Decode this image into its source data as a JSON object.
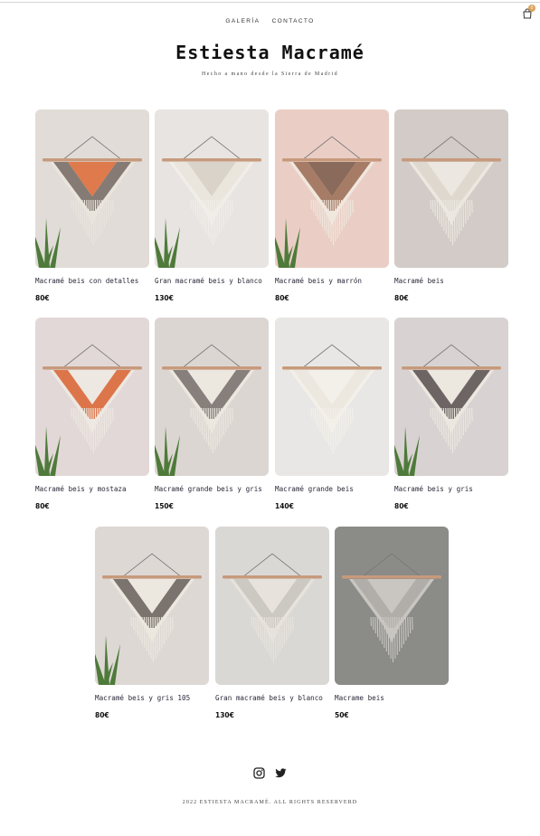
{
  "header": {
    "nav": [
      "GALERÍA",
      "CONTACTO"
    ],
    "cart_count": "0",
    "cart_icon": "shopping-bag-icon"
  },
  "site": {
    "title": "Estiesta Macramé",
    "subtitle": "Hecho a mano desde la Sierra de Madrid"
  },
  "products": [
    {
      "name": "Macramé beis con detalles",
      "price": "80€",
      "bg": "#ddd8d3",
      "tones": [
        "#e9e4dc",
        "#7a6f68",
        "#de7a4c"
      ],
      "plant": true
    },
    {
      "name": "Gran macramé beis y blanco",
      "price": "130€",
      "bg": "#e4e1dd",
      "tones": [
        "#f1eee9",
        "#e9e4dc",
        "#d9d3c9"
      ],
      "plant": true
    },
    {
      "name": "Macramé beis y marrón",
      "price": "80€",
      "bg": "#e7c8bd",
      "tones": [
        "#f0e7de",
        "#9f7059",
        "#8a6a5a"
      ],
      "plant": true
    },
    {
      "name": "Macramé beis",
      "price": "80€",
      "bg": "#ccc4c0",
      "tones": [
        "#ece7e0",
        "#ddd6cc",
        "#ece7e0"
      ],
      "plant": false
    },
    {
      "name": "Macramé beis y mostaza",
      "price": "80€",
      "bg": "#e0d3d3",
      "tones": [
        "#ede8e1",
        "#d9693a",
        "#ede8e1"
      ],
      "plant": true
    },
    {
      "name": "Macramé grande beis y gris",
      "price": "150€",
      "bg": "#d8d1cc",
      "tones": [
        "#ece7df",
        "#7b7370",
        "#ece7df"
      ],
      "plant": true
    },
    {
      "name": "Macramé grande beis",
      "price": "140€",
      "bg": "#e6e4e2",
      "tones": [
        "#f3f0ea",
        "#ebe6de",
        "#f3f0ea"
      ],
      "plant": false
    },
    {
      "name": "Macramé beis y gris",
      "price": "80€",
      "bg": "#d3cdcc",
      "tones": [
        "#ece7df",
        "#5f5656",
        "#ece7df"
      ],
      "plant": true
    },
    {
      "name": "Macramé beis y gris 105",
      "price": "80€",
      "bg": "#d9d3cf",
      "tones": [
        "#ece7df",
        "#6f6661",
        "#ece7df"
      ],
      "plant": true
    },
    {
      "name": "Gran macramé beis y blanco",
      "price": "130€",
      "bg": "#d5d3d0",
      "tones": [
        "#e7e3dc",
        "#c9c5bf",
        "#e7e3dc"
      ],
      "plant": false
    },
    {
      "name": "Macrame beis",
      "price": "50€",
      "bg": "#7c7b78",
      "tones": [
        "#c9c6c2",
        "#aeaba6",
        "#c9c6c2"
      ],
      "plant": false
    }
  ],
  "social": {
    "icons": [
      "instagram-icon",
      "twitter-icon"
    ]
  },
  "footer": {
    "text": "2022 ESTIESTA MACRAMÉ. ALL RIGHTS RESERVERD"
  }
}
